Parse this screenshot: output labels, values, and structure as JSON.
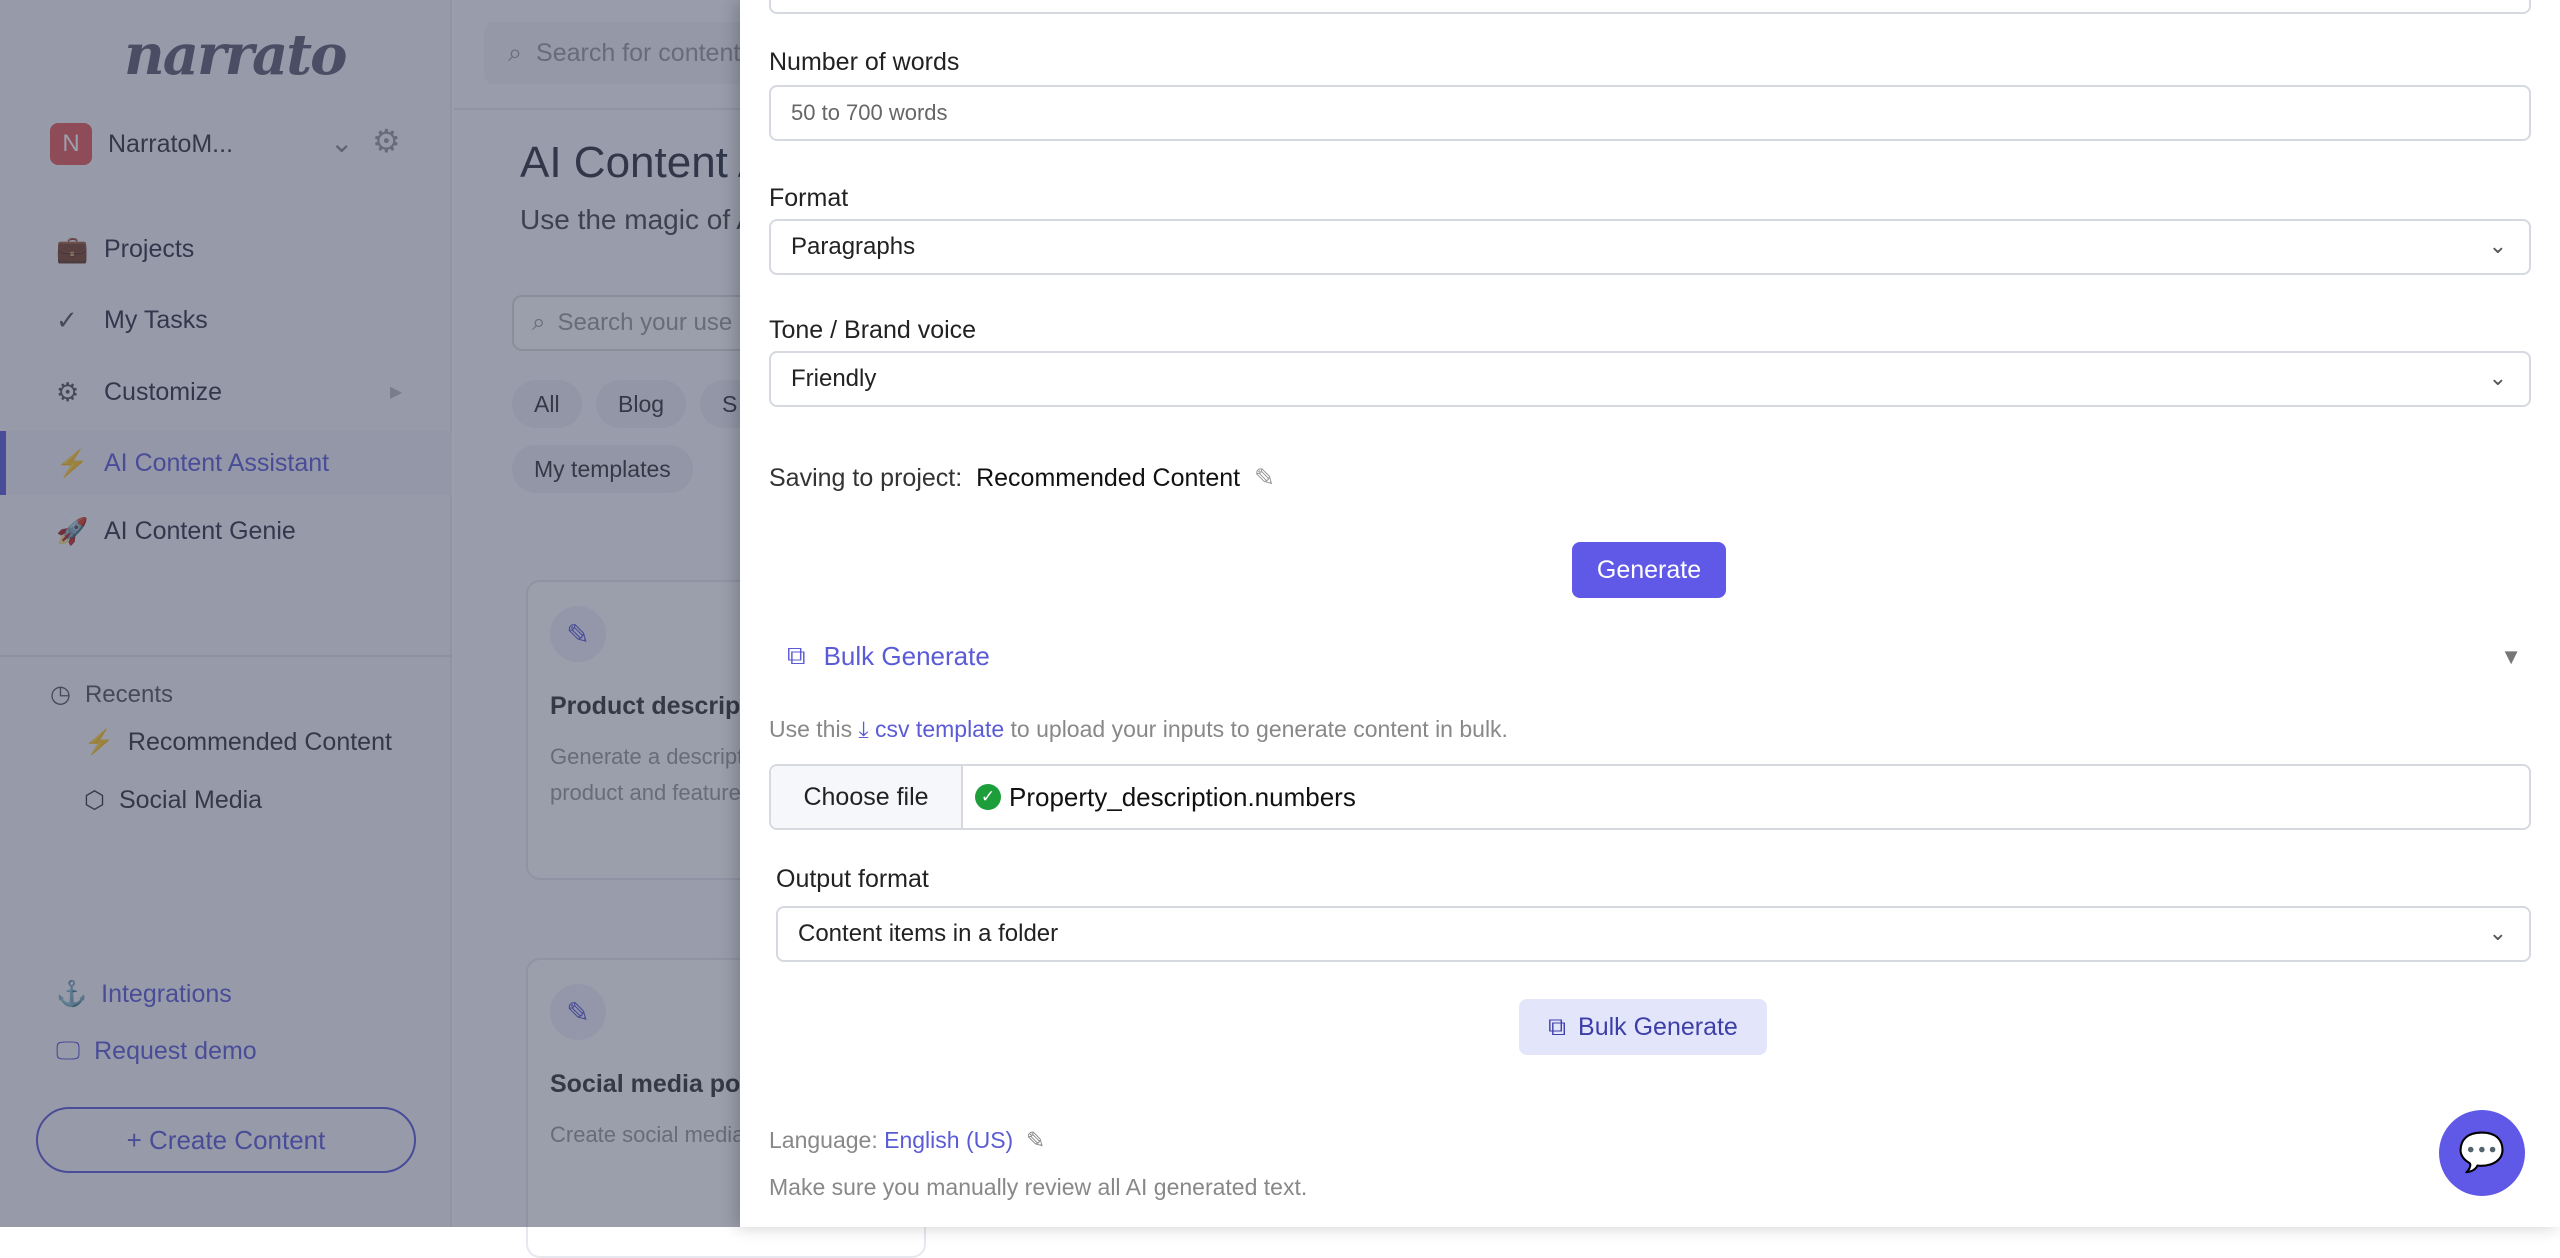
{
  "sidebar": {
    "logo": "narrato",
    "org": {
      "initial": "N",
      "name": "NarratoM..."
    },
    "nav": [
      {
        "label": "Projects",
        "icon": "briefcase-icon"
      },
      {
        "label": "My Tasks",
        "icon": "check-icon"
      },
      {
        "label": "Customize",
        "icon": "gears-icon"
      },
      {
        "label": "AI Content Assistant",
        "icon": "lightning-icon"
      },
      {
        "label": "AI Content Genie",
        "icon": "rocket-icon"
      }
    ],
    "recents_label": "Recents",
    "recents": [
      {
        "label": "Recommended Content"
      },
      {
        "label": "Social Media"
      }
    ],
    "links": [
      {
        "label": "Integrations"
      },
      {
        "label": "Request demo"
      }
    ],
    "create": "+ Create Content"
  },
  "main": {
    "search_placeholder": "Search for content",
    "title": "AI Content Assistant",
    "subtitle": "Use the magic of AI",
    "template_search": "Search your use case",
    "chips": [
      "All",
      "Blog",
      "S",
      "My templates"
    ],
    "cards": [
      {
        "title": "Product description",
        "desc1": "Generate a description of your",
        "desc2": "product and features"
      },
      {
        "title": "Social media post",
        "desc1": "Create social media posts"
      }
    ]
  },
  "panel": {
    "words_label": "Number of words",
    "words_placeholder": "50 to 700 words",
    "format_label": "Format",
    "format_value": "Paragraphs",
    "tone_label": "Tone / Brand voice",
    "tone_value": "Friendly",
    "saving_label": "Saving to project:",
    "saving_project": "Recommended Content",
    "generate": "Generate",
    "bulk_header": "Bulk Generate",
    "csv_pre": "Use this",
    "csv_link": "csv template",
    "csv_post": "to upload your inputs to generate content in bulk.",
    "choose_file": "Choose file",
    "file_name": "Property_description.numbers",
    "output_label": "Output format",
    "output_value": "Content items in a folder",
    "bulk_button": "Bulk Generate",
    "language_label": "Language:",
    "language_value": "English (US)",
    "note": "Make sure you manually review all AI generated text."
  },
  "colors": {
    "accent": "#6059e8",
    "success": "#1e9e3a"
  }
}
